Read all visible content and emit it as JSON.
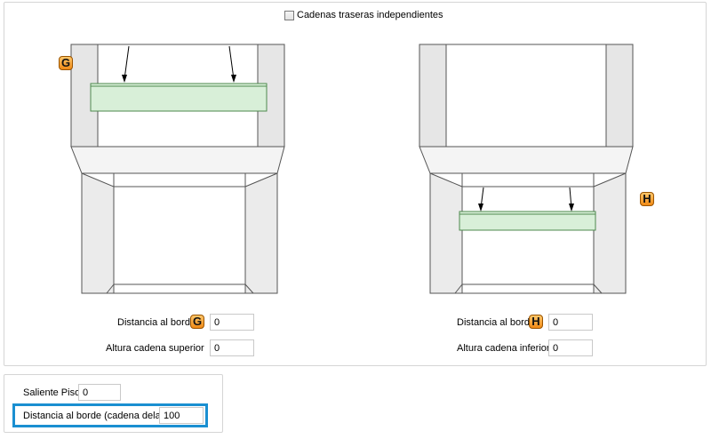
{
  "header": {
    "checkbox_label": "Cadenas traseras independientes",
    "checkbox_checked": false
  },
  "left": {
    "badge": "G",
    "distance_label": "Distancia al borde",
    "distance_badge": "G",
    "distance_value": "0",
    "height_label": "Altura cadena superior",
    "height_value": "0"
  },
  "right": {
    "badge": "H",
    "distance_label": "Distancia al borde",
    "distance_badge": "H",
    "distance_value": "0",
    "height_label": "Altura cadena inferior",
    "height_value": "0"
  },
  "bottom": {
    "floor_label": "Saliente Piso",
    "floor_value": "0",
    "front_label": "Distancia al borde (cadena delantera)",
    "front_value": "100"
  },
  "colors": {
    "accent": "#1a8fd1",
    "badge_fill": "#f6a436",
    "rail_fill": "#d8efd8"
  }
}
